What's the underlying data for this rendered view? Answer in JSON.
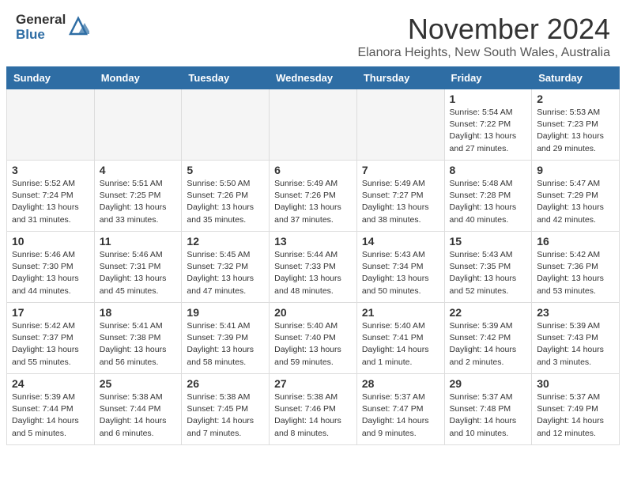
{
  "header": {
    "logo_general": "General",
    "logo_blue": "Blue",
    "month_title": "November 2024",
    "location": "Elanora Heights, New South Wales, Australia"
  },
  "calendar": {
    "days_of_week": [
      "Sunday",
      "Monday",
      "Tuesday",
      "Wednesday",
      "Thursday",
      "Friday",
      "Saturday"
    ],
    "weeks": [
      [
        {
          "num": "",
          "sunrise": "",
          "sunset": "",
          "daylight": "",
          "empty": true
        },
        {
          "num": "",
          "sunrise": "",
          "sunset": "",
          "daylight": "",
          "empty": true
        },
        {
          "num": "",
          "sunrise": "",
          "sunset": "",
          "daylight": "",
          "empty": true
        },
        {
          "num": "",
          "sunrise": "",
          "sunset": "",
          "daylight": "",
          "empty": true
        },
        {
          "num": "",
          "sunrise": "",
          "sunset": "",
          "daylight": "",
          "empty": true
        },
        {
          "num": "1",
          "sunrise": "Sunrise: 5:54 AM",
          "sunset": "Sunset: 7:22 PM",
          "daylight": "Daylight: 13 hours and 27 minutes.",
          "empty": false
        },
        {
          "num": "2",
          "sunrise": "Sunrise: 5:53 AM",
          "sunset": "Sunset: 7:23 PM",
          "daylight": "Daylight: 13 hours and 29 minutes.",
          "empty": false
        }
      ],
      [
        {
          "num": "3",
          "sunrise": "Sunrise: 5:52 AM",
          "sunset": "Sunset: 7:24 PM",
          "daylight": "Daylight: 13 hours and 31 minutes.",
          "empty": false
        },
        {
          "num": "4",
          "sunrise": "Sunrise: 5:51 AM",
          "sunset": "Sunset: 7:25 PM",
          "daylight": "Daylight: 13 hours and 33 minutes.",
          "empty": false
        },
        {
          "num": "5",
          "sunrise": "Sunrise: 5:50 AM",
          "sunset": "Sunset: 7:26 PM",
          "daylight": "Daylight: 13 hours and 35 minutes.",
          "empty": false
        },
        {
          "num": "6",
          "sunrise": "Sunrise: 5:49 AM",
          "sunset": "Sunset: 7:26 PM",
          "daylight": "Daylight: 13 hours and 37 minutes.",
          "empty": false
        },
        {
          "num": "7",
          "sunrise": "Sunrise: 5:49 AM",
          "sunset": "Sunset: 7:27 PM",
          "daylight": "Daylight: 13 hours and 38 minutes.",
          "empty": false
        },
        {
          "num": "8",
          "sunrise": "Sunrise: 5:48 AM",
          "sunset": "Sunset: 7:28 PM",
          "daylight": "Daylight: 13 hours and 40 minutes.",
          "empty": false
        },
        {
          "num": "9",
          "sunrise": "Sunrise: 5:47 AM",
          "sunset": "Sunset: 7:29 PM",
          "daylight": "Daylight: 13 hours and 42 minutes.",
          "empty": false
        }
      ],
      [
        {
          "num": "10",
          "sunrise": "Sunrise: 5:46 AM",
          "sunset": "Sunset: 7:30 PM",
          "daylight": "Daylight: 13 hours and 44 minutes.",
          "empty": false
        },
        {
          "num": "11",
          "sunrise": "Sunrise: 5:46 AM",
          "sunset": "Sunset: 7:31 PM",
          "daylight": "Daylight: 13 hours and 45 minutes.",
          "empty": false
        },
        {
          "num": "12",
          "sunrise": "Sunrise: 5:45 AM",
          "sunset": "Sunset: 7:32 PM",
          "daylight": "Daylight: 13 hours and 47 minutes.",
          "empty": false
        },
        {
          "num": "13",
          "sunrise": "Sunrise: 5:44 AM",
          "sunset": "Sunset: 7:33 PM",
          "daylight": "Daylight: 13 hours and 48 minutes.",
          "empty": false
        },
        {
          "num": "14",
          "sunrise": "Sunrise: 5:43 AM",
          "sunset": "Sunset: 7:34 PM",
          "daylight": "Daylight: 13 hours and 50 minutes.",
          "empty": false
        },
        {
          "num": "15",
          "sunrise": "Sunrise: 5:43 AM",
          "sunset": "Sunset: 7:35 PM",
          "daylight": "Daylight: 13 hours and 52 minutes.",
          "empty": false
        },
        {
          "num": "16",
          "sunrise": "Sunrise: 5:42 AM",
          "sunset": "Sunset: 7:36 PM",
          "daylight": "Daylight: 13 hours and 53 minutes.",
          "empty": false
        }
      ],
      [
        {
          "num": "17",
          "sunrise": "Sunrise: 5:42 AM",
          "sunset": "Sunset: 7:37 PM",
          "daylight": "Daylight: 13 hours and 55 minutes.",
          "empty": false
        },
        {
          "num": "18",
          "sunrise": "Sunrise: 5:41 AM",
          "sunset": "Sunset: 7:38 PM",
          "daylight": "Daylight: 13 hours and 56 minutes.",
          "empty": false
        },
        {
          "num": "19",
          "sunrise": "Sunrise: 5:41 AM",
          "sunset": "Sunset: 7:39 PM",
          "daylight": "Daylight: 13 hours and 58 minutes.",
          "empty": false
        },
        {
          "num": "20",
          "sunrise": "Sunrise: 5:40 AM",
          "sunset": "Sunset: 7:40 PM",
          "daylight": "Daylight: 13 hours and 59 minutes.",
          "empty": false
        },
        {
          "num": "21",
          "sunrise": "Sunrise: 5:40 AM",
          "sunset": "Sunset: 7:41 PM",
          "daylight": "Daylight: 14 hours and 1 minute.",
          "empty": false
        },
        {
          "num": "22",
          "sunrise": "Sunrise: 5:39 AM",
          "sunset": "Sunset: 7:42 PM",
          "daylight": "Daylight: 14 hours and 2 minutes.",
          "empty": false
        },
        {
          "num": "23",
          "sunrise": "Sunrise: 5:39 AM",
          "sunset": "Sunset: 7:43 PM",
          "daylight": "Daylight: 14 hours and 3 minutes.",
          "empty": false
        }
      ],
      [
        {
          "num": "24",
          "sunrise": "Sunrise: 5:39 AM",
          "sunset": "Sunset: 7:44 PM",
          "daylight": "Daylight: 14 hours and 5 minutes.",
          "empty": false
        },
        {
          "num": "25",
          "sunrise": "Sunrise: 5:38 AM",
          "sunset": "Sunset: 7:44 PM",
          "daylight": "Daylight: 14 hours and 6 minutes.",
          "empty": false
        },
        {
          "num": "26",
          "sunrise": "Sunrise: 5:38 AM",
          "sunset": "Sunset: 7:45 PM",
          "daylight": "Daylight: 14 hours and 7 minutes.",
          "empty": false
        },
        {
          "num": "27",
          "sunrise": "Sunrise: 5:38 AM",
          "sunset": "Sunset: 7:46 PM",
          "daylight": "Daylight: 14 hours and 8 minutes.",
          "empty": false
        },
        {
          "num": "28",
          "sunrise": "Sunrise: 5:37 AM",
          "sunset": "Sunset: 7:47 PM",
          "daylight": "Daylight: 14 hours and 9 minutes.",
          "empty": false
        },
        {
          "num": "29",
          "sunrise": "Sunrise: 5:37 AM",
          "sunset": "Sunset: 7:48 PM",
          "daylight": "Daylight: 14 hours and 10 minutes.",
          "empty": false
        },
        {
          "num": "30",
          "sunrise": "Sunrise: 5:37 AM",
          "sunset": "Sunset: 7:49 PM",
          "daylight": "Daylight: 14 hours and 12 minutes.",
          "empty": false
        }
      ]
    ]
  }
}
